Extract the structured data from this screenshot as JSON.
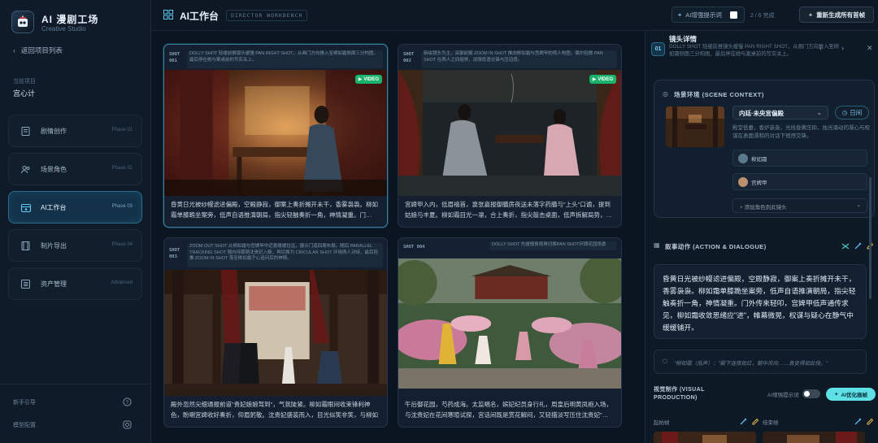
{
  "sidebar": {
    "app_title": "AI 漫剧工场",
    "app_subtitle": "Creative Studio",
    "back_label": "返回项目列表",
    "project_label": "当前项目",
    "project_name": "宫心计",
    "nav": [
      {
        "label": "剧情创作",
        "phase": "Phase 01",
        "icon": "book-icon",
        "active": false
      },
      {
        "label": "场景角色",
        "phase": "Phase 02",
        "icon": "users-icon",
        "active": false
      },
      {
        "label": "AI工作台",
        "phase": "Phase 03",
        "icon": "workbench-icon",
        "active": true
      },
      {
        "label": "制片导出",
        "phase": "Phase 04",
        "icon": "film-icon",
        "active": false
      },
      {
        "label": "资产管理",
        "phase": "Advanced",
        "icon": "list-icon",
        "active": false
      }
    ],
    "footer": {
      "guide": "新手引导",
      "settings": "模型配置"
    }
  },
  "header": {
    "title": "AI工作台",
    "badge": "DIRECTOR WORKBENCH",
    "enhance_label": "AI增强提示词",
    "progress": "2 / 6 完成",
    "regen_label": "重新生成所有首帧"
  },
  "shots": [
    {
      "tag1": "SHOT",
      "tag2": "001",
      "desc": "DOLLY SHOT 轻缓前推镜头缓慢 PAN RIGHT SHOT，从画门方向推入至柳如霜侧面三分构图，最后停在她与案桌前的写实关上。",
      "has_video": true,
      "video_label": "VIDEO",
      "text": "昏黄日光被纱幔滤进偏殿，空殿静寂，御案上奏折摊开未干，香雾袅袅。柳如霜单膝跪坐案旁，低声自语推演朝局，指尖轻触奏折一角，神情凝重。门…"
    },
    {
      "tag1": "SHOT",
      "tag2": "002",
      "desc": "新绘镜头为主，采御前摄 ZOOM IN SHOT 推向柳如霜与宫婢甲的两人构图，偶尔轻微 PAN SHOT 在两人之间摇移，加强低语交锋与压迫感。",
      "has_video": true,
      "video_label": "VIDEO",
      "text": "宫婢甲入内，低眉禧首，禀张嘉报御膳房夜送未落字药膳与\"上头\"口谕，提到姑娘与丰夏。柳如霜目光一凛，合上奏折，指尖敲击桌面，低声拆解局势，…"
    },
    {
      "tag1": "SHOT",
      "tag2": "003",
      "desc": "ZOOM OUT SHOT 从柳如霜与宫婢甲中近景缓缓拉远，展示门道四周布局。随后 PARALLEL TRACKING SHOT 随内侍跟随沈贵妃入殿，再切换为 CIRCULAR SHOT 环绕两人对峙，最后轻推 ZOOM IN SHOT 落至柳如霜子心追问后的神情。",
      "has_video": false,
      "video_label": "VIDEO",
      "text": "殿外忽然尖细通报前道\"贵妃娘娘驾到\"，气氛陡紧。柳如霜眼间收束锋利神色，盼喇宫婢收好奏折，仰眉躬敬。沈贵妃盛装而入，目光似笑非笑，与柳如霜…"
    },
    {
      "tag1": "SHOT",
      "tag2": "004",
      "desc": "DOLLY SHOT 先缓慢俯视再切换PAN SHOT环顾花园场景",
      "has_video": false,
      "video_label": "VIDEO",
      "text": "午后御花园，芍药成海。太监唱名，嫔妃纪员身行礼，周皇后明黄凤袍入场，与沈贵妃在花间寒暄试探，宫话间既是赏花解闷，又轻描淡写压住沈贵妃\"…"
    }
  ],
  "detail": {
    "shot_num": "01",
    "title": "镜头详情",
    "subtitle": "DOLLY SHOT 轻缓前推镜头缓慢 PAN RIGHT SHOT，从画门方向推入至柳如霜侧面三分构图，最后停在她与案桌前的写实关上。",
    "scene_title": "场景环境 (SCENE CONTEXT)",
    "location": "内廷·未央宫偏殿",
    "time": "日间",
    "scene_desc": "殿堂低垂，香炉袅袅，光线昏黄压抑，烛光涌动的凝心与权谋在表面漂和的对话下悄然交锋。",
    "characters": [
      "柳如霜",
      "宫婢甲"
    ],
    "add_character": "+ 添加角色到此镜头",
    "action_title": "叙事动作 (ACTION & DIALOGUE)",
    "action_text": "昏黄日光被纱幔滤进偏殿，空殿静寂，御案上奏折摊开未干，香雾袅袅。柳如霜单膝跪坐案旁，低声自语推演朝局，指尖轻触奏折一角，神情凝重。门外传来轻叩，宫婢甲低声通传求见，柳如霜收敛思绪应\"进\"，帷幕微晃，权谋与疑心在静气中缓缓铺开。",
    "dialogue": "\"柳如霜（低声）：\"殿下连夜批红，朝中风向……真变得如此快。\"",
    "visual_title": "视觉制作 (VISUAL PRODUCTION)",
    "enhance_label": "AI增强提示词",
    "ai_btn": "AI优化画帧",
    "start_frame": "起始帧",
    "end_frame": "结束帧"
  },
  "colors": {
    "accent": "#38bdf8",
    "video_badge": "#19b36b",
    "ai_button": "#5ee0e6"
  }
}
